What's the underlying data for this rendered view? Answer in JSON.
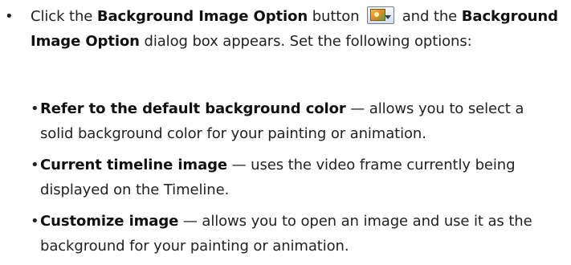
{
  "intro": {
    "bullet": "•",
    "part1": "Click the ",
    "bold1": "Background Image Option",
    "part2": " button ",
    "part3": " and the ",
    "bold2": "Background Image Option",
    "part4": " dialog box appears. Set the following options:",
    "button_icon": "background-image-option-icon"
  },
  "options": [
    {
      "bullet": "•",
      "term": "Refer to the default background color",
      "desc": " — allows you to select a solid background color for your painting or animation."
    },
    {
      "bullet": "•",
      "term": "Current timeline image",
      "desc": " — uses the video frame currently being displayed on the Timeline."
    },
    {
      "bullet": "•",
      "term": "Customize image",
      "desc": " — allows you to open an image and use it as the background for your painting or animation."
    }
  ]
}
